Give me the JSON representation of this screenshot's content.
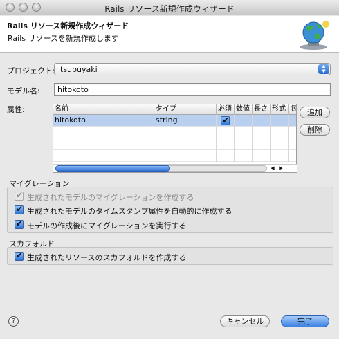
{
  "window": {
    "title": "Rails リソース新規作成ウィザード"
  },
  "banner": {
    "title": "Rails リソース新規作成ウィザード",
    "description": "Rails リソースを新規作成します",
    "icon": "globe-wizard-icon"
  },
  "project": {
    "label": "プロジェクト:",
    "value": "tsubuyaki"
  },
  "model": {
    "label": "モデル名:",
    "value": "hitokoto"
  },
  "attributes": {
    "label": "属性:",
    "columns": [
      "名前",
      "タイプ",
      "必須",
      "数値",
      "長さ",
      "形式",
      "包"
    ],
    "rows": [
      {
        "name": "hitokoto",
        "type": "string",
        "required": true
      }
    ],
    "add_label": "追加",
    "delete_label": "削除"
  },
  "migration": {
    "label": "マイグレーション",
    "items": [
      {
        "text": "生成されたモデルのマイグレーションを作成する",
        "checked": true,
        "enabled": false
      },
      {
        "text": "生成されたモデルのタイムスタンプ属性を自動的に作成する",
        "checked": true,
        "enabled": true
      },
      {
        "text": "モデルの作成後にマイグレーションを実行する",
        "checked": true,
        "enabled": true
      }
    ]
  },
  "scaffold": {
    "label": "スカフォルド",
    "items": [
      {
        "text": "生成されたリソースのスカフォルドを作成する",
        "checked": true,
        "enabled": true
      }
    ]
  },
  "footer": {
    "help": "?",
    "cancel_label": "キャンセル",
    "finish_label": "完了"
  }
}
